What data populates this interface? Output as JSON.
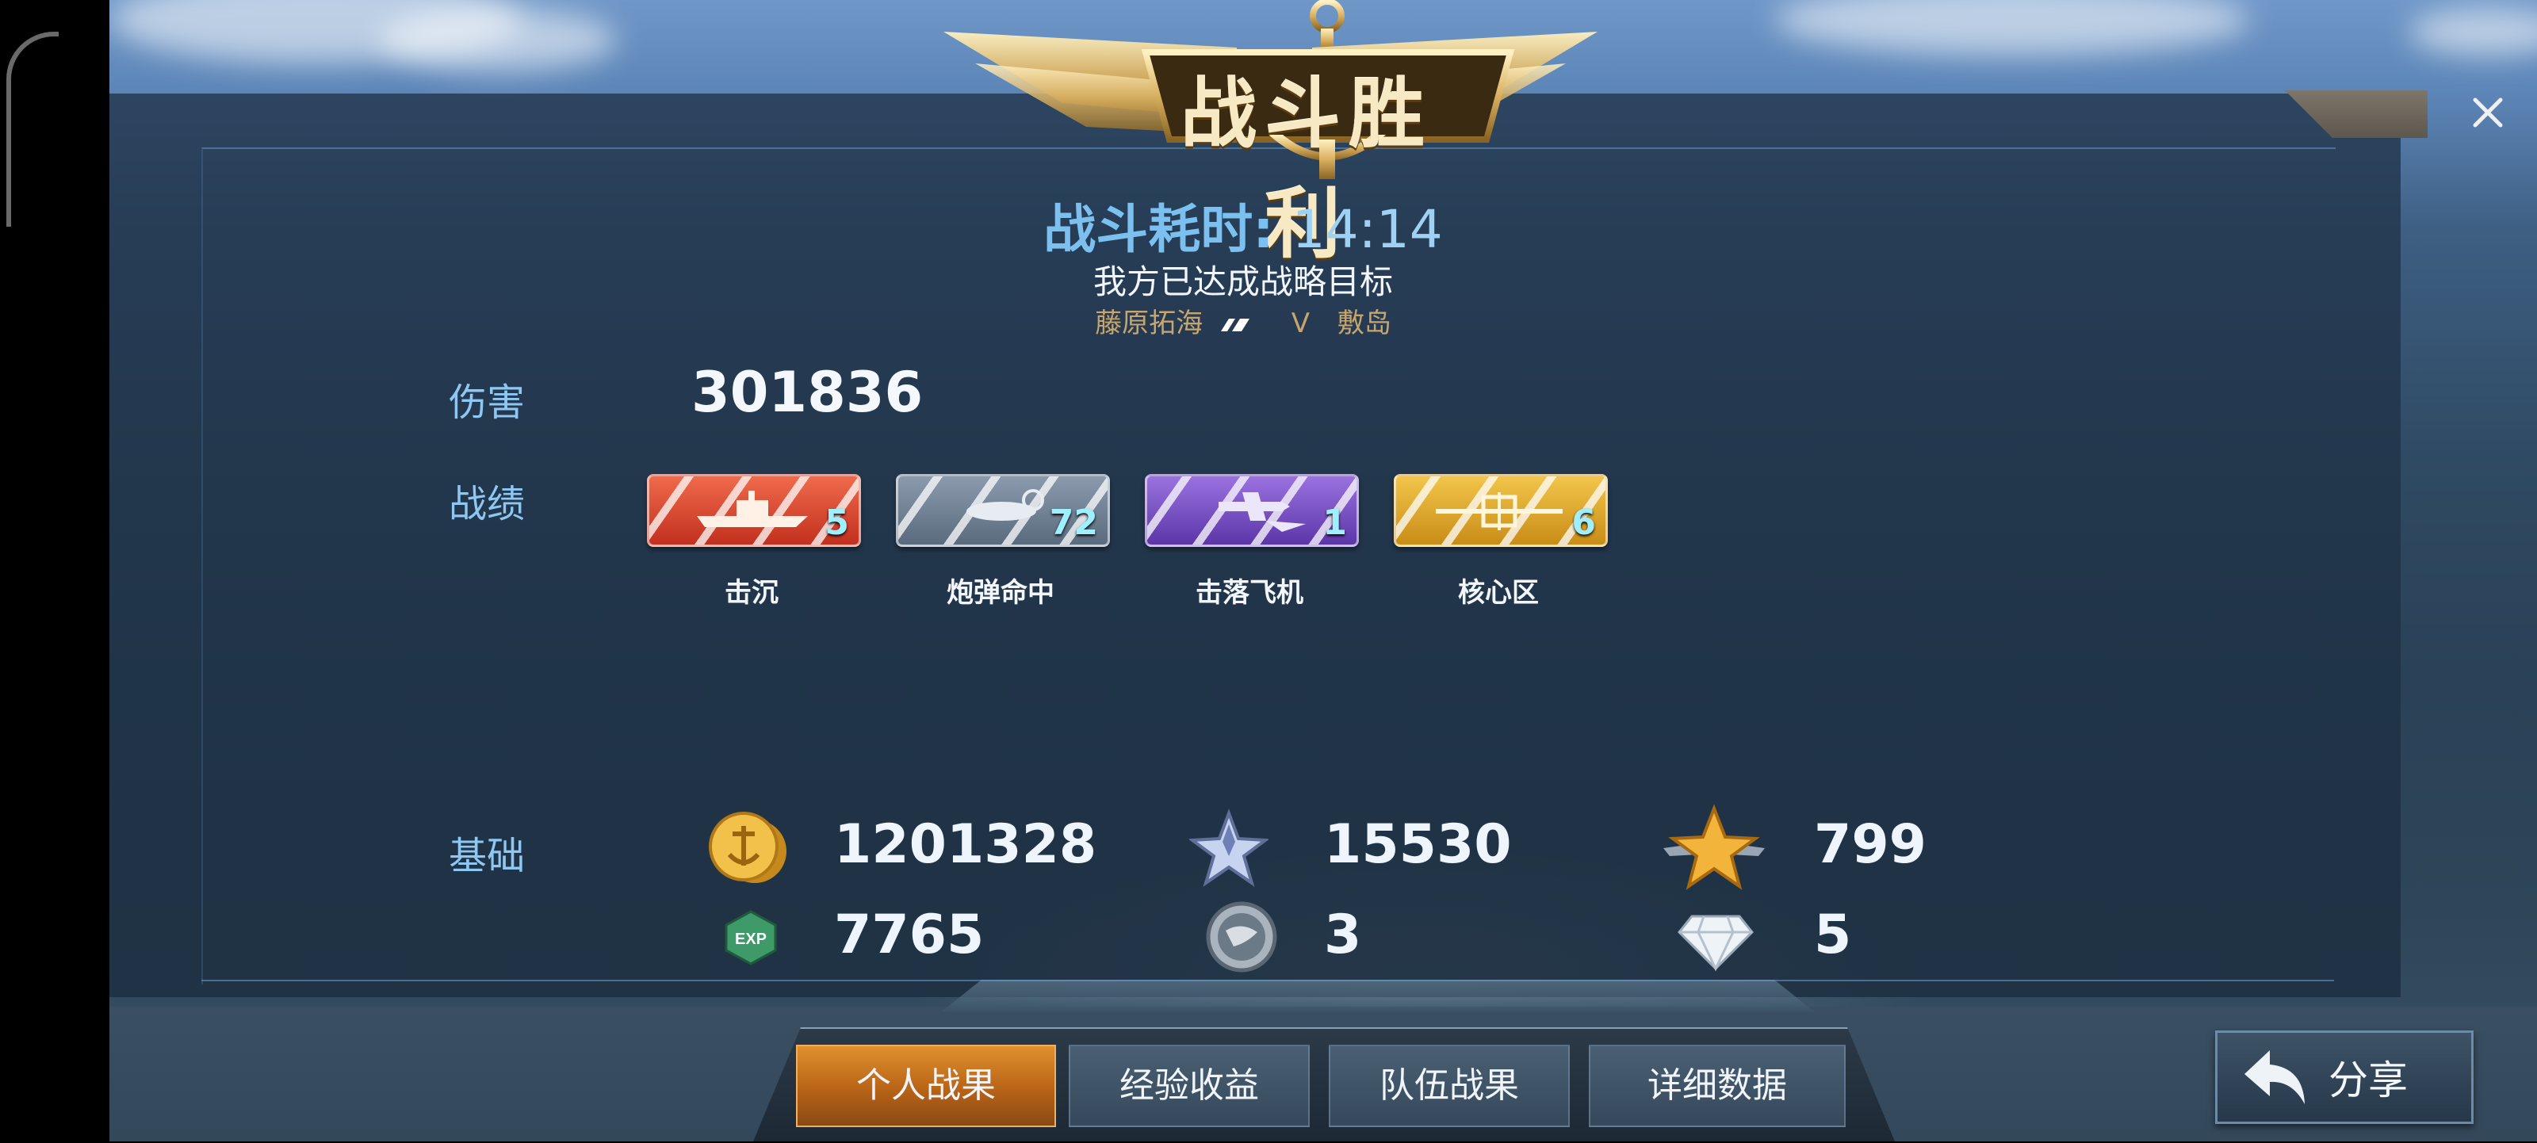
{
  "title": "战斗胜利",
  "battle": {
    "time_label": "战斗耗时:",
    "time_value": "14:14",
    "objective": "我方已达成战略目标",
    "player_left": "藤原拓海",
    "vs": "V",
    "player_right": "敷岛"
  },
  "damage": {
    "label": "伤害",
    "value": "301836"
  },
  "record": {
    "label": "战绩",
    "medals": [
      {
        "label": "击沉",
        "count": "5",
        "color": "#d9442f"
      },
      {
        "label": "炮弹命中",
        "count": "72",
        "color": "#6c7d90"
      },
      {
        "label": "击落飞机",
        "count": "1",
        "color": "#7a4fc8"
      },
      {
        "label": "核心区",
        "count": "6",
        "color": "#e2a92a"
      }
    ]
  },
  "base": {
    "label": "基础",
    "stats": [
      {
        "icon": "gold-coin-icon",
        "value": "1201328"
      },
      {
        "icon": "silver-star-icon",
        "value": "15530"
      },
      {
        "icon": "gold-star-wings-icon",
        "value": "799"
      },
      {
        "icon": "exp-icon",
        "value": "7765"
      },
      {
        "icon": "globe-medal-icon",
        "value": "3"
      },
      {
        "icon": "diamond-icon",
        "value": "5"
      }
    ],
    "exp_badge": "EXP"
  },
  "tabs": [
    {
      "label": "个人战果",
      "active": true
    },
    {
      "label": "经验收益",
      "active": false
    },
    {
      "label": "队伍战果",
      "active": false
    },
    {
      "label": "详细数据",
      "active": false
    }
  ],
  "share": {
    "label": "分享"
  },
  "colors": {
    "accent_blue": "#8ec8f2",
    "gold": "#e2a92a",
    "tab_active": "#d98a2c"
  }
}
